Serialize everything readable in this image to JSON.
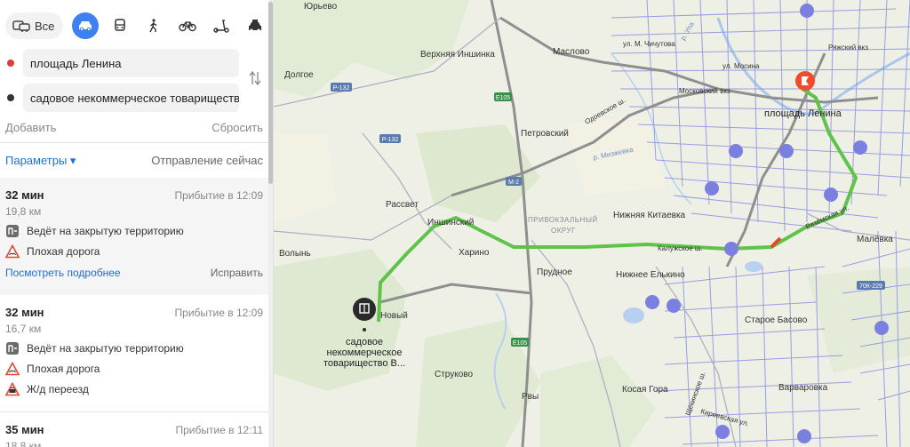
{
  "transport": {
    "all_label": "Все",
    "modes": [
      "car",
      "bus",
      "pedestrian",
      "bicycle",
      "scooter",
      "taxi"
    ]
  },
  "waypoints": {
    "from": "площадь Ленина",
    "to": "садовое некоммерческое товарищество...",
    "from_color": "#e33a31",
    "to_color": "#333333"
  },
  "actions": {
    "add": "Добавить",
    "reset": "Сбросить"
  },
  "params": {
    "label": "Параметры ▾",
    "departure": "Отправление сейчас"
  },
  "routes": [
    {
      "time": "32 мин",
      "arrival": "Прибытие в 12:09",
      "distance": "19,8 км",
      "warnings": [
        "Ведёт на закрытую территорию",
        "Плохая дорога"
      ],
      "more": "Посмотреть подробнее",
      "fix": "Исправить"
    },
    {
      "time": "32 мин",
      "arrival": "Прибытие в 12:09",
      "distance": "16,7 км",
      "warnings": [
        "Ведёт на закрытую территорию",
        "Плохая дорога",
        "Ж/д переезд"
      ]
    },
    {
      "time": "35 мин",
      "arrival": "Прибытие в 12:11",
      "distance": "18,8 км"
    }
  ],
  "map": {
    "places": {
      "yurevo": "Юрьево",
      "dolgoe": "Долгое",
      "verkh_inshinka": "Верхняя Иншинка",
      "maslovo": "Маслово",
      "petrovsky": "Петровский",
      "rassvet": "Рассвет",
      "inshinsky": "Иншинский",
      "kharino": "Харино",
      "volyn": "Волынь",
      "novy": "Новый",
      "prudnoe": "Прудное",
      "nizhnyaya_kitaevka": "Нижняя Китаевка",
      "nizhnee_elkino": "Нижнее Елькино",
      "strukovo": "Струково",
      "rvy": "Рвы",
      "kosaya_gora": "Косая Гора",
      "staroe_basovo": "Старое Басово",
      "varvarovka": "Варваровка",
      "malevka": "Малёвка",
      "privokzalny": "ПРИВОКЗАЛЬНЫЙ",
      "okrug": "ОКРУГ",
      "moskovsky_vkz": "Московский вкз",
      "ryazhsky_vkz": "Ряжский вкз",
      "kaluzhskoe_sh": "Калужское ш.",
      "vyazemskaya": "Вязёмская ул.",
      "odoevskoe_sh": "Одоевское ш.",
      "r_mizh": "р. Мизжевка",
      "ul_m_lychutova": "ул. М. Чичутова",
      "ul_mosina": "ул. Мосина",
      "shchekinskoe_sh": "Щёкинское ш.",
      "kireevskaya": "Киреевская ул.",
      "r_upa": "р. Упа"
    },
    "roads": {
      "r132a": "Р-132",
      "r132b": "Р-132",
      "e105a": "E105",
      "m2": "М-2",
      "e105b": "E105",
      "k229": "70К-229"
    },
    "destination_label": "площадь Ленина",
    "origin_label_line1": "садовое",
    "origin_label_line2": "некоммерческое",
    "origin_label_line3": "товарищество В...",
    "colors": {
      "route_main": "#5fc34a",
      "route_alt": "#b2b6c8",
      "traffic_red": "#e5472d",
      "destination": "#f04b2d",
      "accent": "#3d80f2"
    }
  }
}
